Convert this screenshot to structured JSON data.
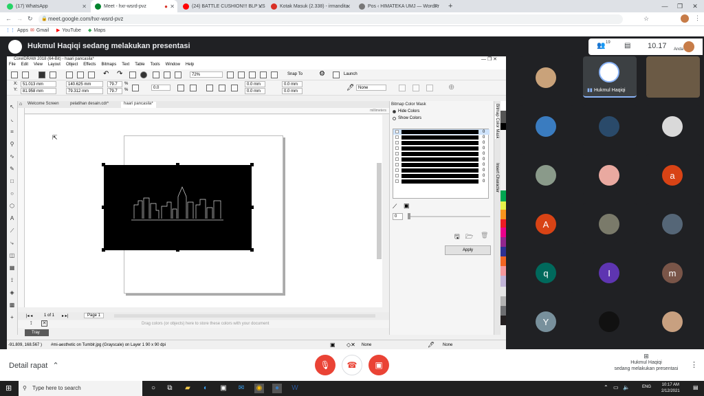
{
  "browser": {
    "tabs": [
      {
        "label": "(17) WhatsApp",
        "color": "#25d366"
      },
      {
        "label": "Meet - hxr-wsrd-pvz",
        "color": "#00832d"
      },
      {
        "label": "(24) BATTLE CUSHION!!! BLP VS",
        "color": "#ff0000"
      },
      {
        "label": "Kotak Masuk (2.338) - irmandita",
        "color": "#d93025"
      },
      {
        "label": "Pos ‹ HIMATEKA UMJ — WordPr",
        "color": "#777777"
      }
    ],
    "new_tab": "+",
    "url": "meet.google.com/hxr-wsrd-pvz",
    "bookmarks": [
      "Apps",
      "Gmail",
      "YouTube",
      "Maps"
    ]
  },
  "meet": {
    "banner": "Hukmul Haqiqi sedang melakukan presentasi",
    "participant_count": "19",
    "time": "10.17",
    "self_label": "Anda",
    "featured_name": "Hukmul Haqiqi",
    "meeting_details": "Detail rapat",
    "presenting_name": "Hukmul Haqiqi",
    "presenting_status": "sedang melakukan presentasi",
    "tiles": [
      {
        "label": "",
        "color": "#c9a27a"
      },
      {
        "label": "",
        "color": "#ffffff"
      },
      {
        "label": "",
        "color": "#6b5a45"
      },
      {
        "label": "",
        "color": "#3a7cc0"
      },
      {
        "label": "",
        "color": "#2a4a6a"
      },
      {
        "label": "",
        "color": "#d9d9d9"
      },
      {
        "label": "",
        "color": "#8a9a8a"
      },
      {
        "label": "",
        "color": "#e9a9a0"
      },
      {
        "label": "a",
        "color": "#d84315"
      },
      {
        "label": "A",
        "color": "#d84315"
      },
      {
        "label": "",
        "color": "#7a7a6a"
      },
      {
        "label": "",
        "color": "#556677"
      },
      {
        "label": "q",
        "color": "#00695c"
      },
      {
        "label": "I",
        "color": "#5e35b1"
      },
      {
        "label": "m",
        "color": "#795548"
      },
      {
        "label": "Y",
        "color": "#78909c"
      },
      {
        "label": "",
        "color": "#111111"
      },
      {
        "label": "",
        "color": "#c8a080"
      }
    ]
  },
  "corel": {
    "title": "CorelDRAW 2018 (64-Bit) - haari pancasila*",
    "menu": [
      "File",
      "Edit",
      "View",
      "Layout",
      "Object",
      "Effects",
      "Bitmaps",
      "Text",
      "Table",
      "Tools",
      "Window",
      "Help"
    ],
    "zoom": "72%",
    "snap_to": "Snap To",
    "launch": "Launch",
    "x_pos": "51.013 mm",
    "y_pos": "81.958 mm",
    "width": "140.625 mm",
    "height": "79.312 mm",
    "scale_w": "79.7",
    "scale_h": "79.7",
    "pct": "%",
    "angle": "0.0",
    "mm1": "0.0 mm",
    "mm2": "0.0 mm",
    "mm3": "0.0 mm",
    "mm4": "0.0 mm",
    "none": "None",
    "doc_tabs": [
      "Welcome Screen",
      "pelatihan desain.cdr*",
      "haari pancasila*"
    ],
    "ruler_unit": "millimeters",
    "page_nav": "1 of 1",
    "page_tab": "Page 1",
    "palette_hint": "Drag colors (or objects) here to store these colors with your document",
    "tray": "Tray",
    "status_coords": "-91.809, 168.567 )",
    "status_text": "#mi-aesthetic on Tumblr.jpg (Grayscale) on Layer 1 90 x 90 dpi",
    "status_fill": "None",
    "status_outline": "None",
    "docker": {
      "title": "Bitmap Color Mask",
      "hide": "Hide Colors",
      "show": "Show Colors",
      "values": [
        "0",
        "0",
        "0",
        "0",
        "0",
        "0",
        "0",
        "0",
        "0",
        "0"
      ],
      "tolerance": "0",
      "apply": "Apply",
      "side_tab1": "Bitmap Color Mask",
      "side_tab2": "Insert Character"
    }
  },
  "taskbar": {
    "search": "Type here to search",
    "time": "10:17 AM",
    "date": "2/12/2021",
    "lang": "ENG"
  }
}
